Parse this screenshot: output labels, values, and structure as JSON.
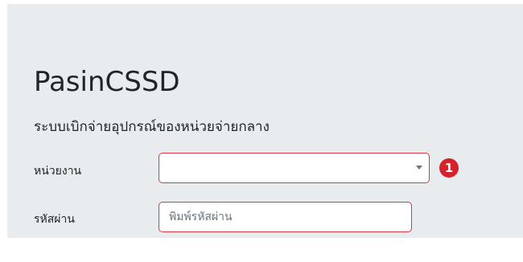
{
  "app": {
    "title": "PasinCSSD",
    "subtitle": "ระบบเบิกจ่ายอุปกรณ์ของหน่วยจ่ายกลาง"
  },
  "form": {
    "department": {
      "label": "หน่วยงาน",
      "value": "",
      "step_badge": "1"
    },
    "password": {
      "label": "รหัสผ่าน",
      "value": "",
      "placeholder": "พิมพ์รหัสผ่าน"
    }
  },
  "colors": {
    "panel_background": "#e9ecef",
    "invalid_border": "#dc3545",
    "badge": "#d4232b"
  },
  "icons": {
    "select_caret": "chevron-down-icon"
  }
}
